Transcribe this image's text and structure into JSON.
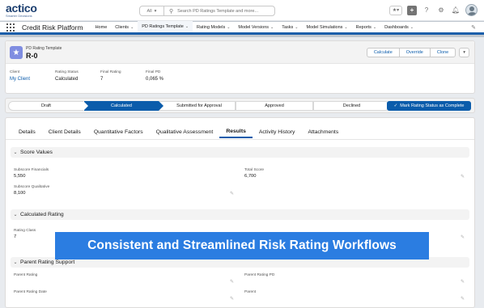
{
  "brand": {
    "logo_text": "actico",
    "logo_sub": "Smarter Decisions",
    "accent": "#0b5cab",
    "banner_color": "#2b7de1"
  },
  "search": {
    "scope": "All",
    "placeholder": "Search PD Ratings Template and more..."
  },
  "utility_icons": [
    "favorites-icon",
    "add-icon",
    "help-icon",
    "gear-icon",
    "notification-bell-icon",
    "avatar"
  ],
  "nav": {
    "app_name": "Credit Risk Platform",
    "items": [
      {
        "label": "Home",
        "has_chevron": false
      },
      {
        "label": "Clients",
        "has_chevron": true
      },
      {
        "label": "PD Ratings Template",
        "has_chevron": true,
        "active": true
      },
      {
        "label": "Rating Models",
        "has_chevron": true
      },
      {
        "label": "Model Versions",
        "has_chevron": true
      },
      {
        "label": "Tasks",
        "has_chevron": true
      },
      {
        "label": "Model Simulations",
        "has_chevron": true
      },
      {
        "label": "Reports",
        "has_chevron": true
      },
      {
        "label": "Dashboards",
        "has_chevron": true
      }
    ]
  },
  "record": {
    "type_label": "PD Rating Template",
    "name": "R-0",
    "actions": [
      "Calculate",
      "Override",
      "Clone"
    ],
    "fields": [
      {
        "label": "Client",
        "value": "My Client",
        "link": true
      },
      {
        "label": "Rating Status",
        "value": "Calculated",
        "link": false
      },
      {
        "label": "Final Rating",
        "value": "7",
        "link": false
      },
      {
        "label": "Final PD",
        "value": "0,065 %",
        "link": false
      }
    ]
  },
  "path": {
    "steps": [
      "Draft",
      "Calculated",
      "Submitted for Approval",
      "Approved",
      "Declined"
    ],
    "current_index": 1,
    "mark_button": "Mark Rating Status as Complete"
  },
  "tabs": [
    "Details",
    "Client Details",
    "Quantitative Factors",
    "Qualitative Assessment",
    "Results",
    "Activity History",
    "Attachments"
  ],
  "active_tab": "Results",
  "sections": {
    "score_values": {
      "title": "Score Values",
      "subscore_financials_label": "Subscore Financials",
      "subscore_financials_value": "5,550",
      "total_score_label": "Total Score",
      "total_score_value": "6,700",
      "subscore_qualitative_label": "Subscore Qualitative",
      "subscore_qualitative_value": "8,100"
    },
    "calculated_rating": {
      "title": "Calculated Rating",
      "rating_class_label": "Rating Class",
      "rating_class_value": "7"
    },
    "parent_rating": {
      "title": "Parent Rating Support",
      "parent_rating_label": "Parent Rating",
      "parent_rating_pd_label": "Parent Rating PD",
      "parent_rating_date_label": "Parent Rating Date",
      "parent_label": "Parent"
    }
  },
  "banner": {
    "text": "Consistent and Streamlined Risk Rating Workflows"
  }
}
